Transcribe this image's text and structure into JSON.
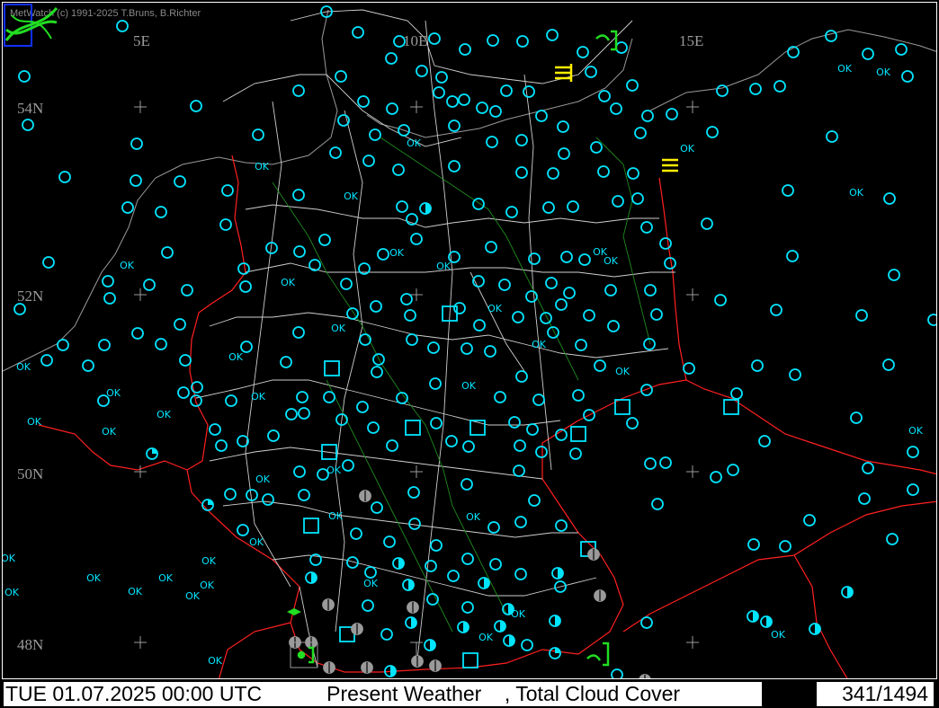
{
  "credit": "MetWatch  (c) 1991-2025 T.Bruns, B.Richter",
  "logo_icon": "metwatch-logo-icon",
  "grid_labels": {
    "lon_5e": "5E",
    "lon_10e": "10E",
    "lon_15e": "15E",
    "lat_54n": "54N",
    "lat_52n": "52N",
    "lat_50n": "50N",
    "lat_48n": "48N"
  },
  "ok_label": "OK",
  "status": {
    "datetime": "TUE 01.07.2025 00:00 UTC",
    "product": "   Present Weather    , Total Cloud Cover",
    "counter": "341/1494"
  },
  "colors": {
    "background": "#000000",
    "station_clear": "#00e5ff",
    "station_overcast": "#9a9a9a",
    "borders": "#ff2020",
    "admin_lines": "#cfcfcf",
    "rivers": "#1f8a1f",
    "fog_symbol": "#ffee00",
    "thunder_symbol": "#22dd22"
  }
}
